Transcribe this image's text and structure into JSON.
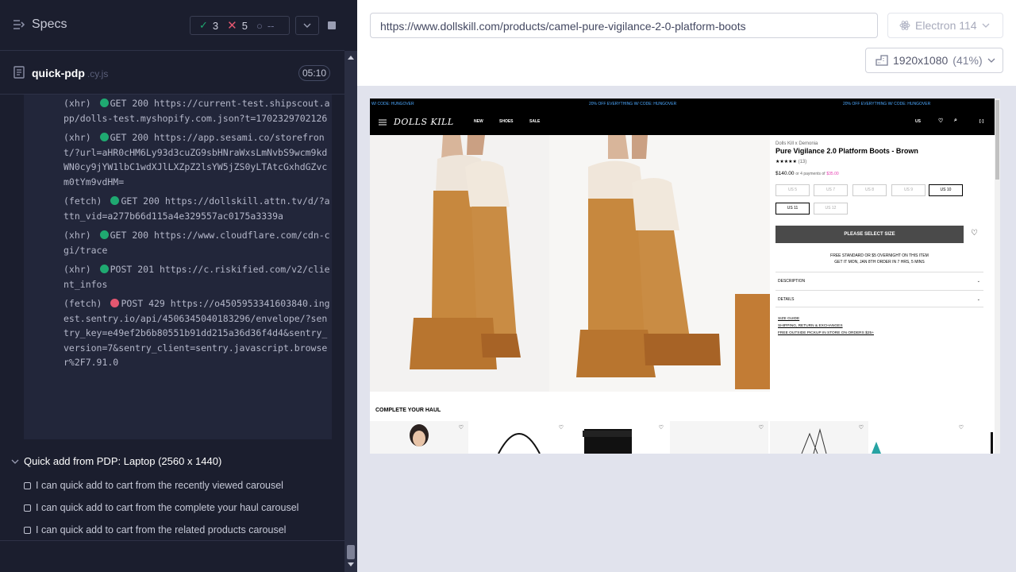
{
  "header": {
    "title": "Specs",
    "passed": "3",
    "failed": "5",
    "pending": "--"
  },
  "spec_file": {
    "name": "quick-pdp",
    "ext": ".cy.js",
    "duration": "05:10"
  },
  "logs": [
    {
      "type": "(xhr)",
      "status": "pass",
      "method": "GET 200",
      "url": "https://current-test.shipscout.app/dolls-test.myshopify.com.json?t=1702329702126"
    },
    {
      "type": "(xhr)",
      "status": "pass",
      "method": "GET 200",
      "url": "https://app.sesami.co/storefront/?url=aHR0cHM6Ly93d3cuZG9sbHNraWxsLmNvbS9wcm9kdWN0cy9jYW1lbC1wdXJlLXZpZ2lsYW5jZS0yLTAtcGxhdGZvcm0tYm9vdHM="
    },
    {
      "type": "(fetch)",
      "status": "pass",
      "method": "GET 200",
      "url": "https://dollskill.attn.tv/d/?attn_vid=a277b66d115a4e329557ac0175a3339a"
    },
    {
      "type": "(xhr)",
      "status": "pass",
      "method": "GET 200",
      "url": "https://www.cloudflare.com/cdn-cgi/trace"
    },
    {
      "type": "(xhr)",
      "status": "pass",
      "method": "POST 201",
      "url": "https://c.riskified.com/v2/client_infos"
    },
    {
      "type": "(fetch)",
      "status": "fail",
      "method": "POST 429",
      "url": "https://o4505953341603840.ingest.sentry.io/api/4506345040183296/envelope/?sentry_key=e49ef2b6b80551b91dd215a36d36f4d4&sentry_version=7&sentry_client=sentry.javascript.browser%2F7.91.0"
    }
  ],
  "suite": {
    "title": "Quick add from PDP: Laptop (2560 x 1440)"
  },
  "tests": [
    "I can quick add to cart from the recently viewed carousel",
    "I can quick add to cart from the complete your haul carousel",
    "I can quick add to cart from the related products carousel"
  ],
  "browser": {
    "url": "https://www.dollskill.com/products/camel-pure-vigilance-2-0-platform-boots",
    "engine": "Electron 114",
    "viewport": "1920x1080",
    "scale": "(41%)"
  },
  "colors": {
    "pass": "#1fa971",
    "fail": "#e45770",
    "accent": "#e63ab1"
  },
  "site": {
    "promo": [
      "W/ CODE: HUNGOVER",
      "20% OFF EVERYTHING W/ CODE: HUNGOVER",
      "20% OFF EVERYTHING W/ CODE: HUNGOVER"
    ],
    "logo": "DOLLS KILL",
    "nav": [
      "NEW",
      "SHOES",
      "SALE"
    ],
    "region": "US",
    "brand": "Dolls Kill x Demonia",
    "title": "Pure Vigilance 2.0 Platform Boots - Brown",
    "stars": "★★★★★",
    "reviews": "(13)",
    "price": "$140.00",
    "installments": "or 4 payments of",
    "installment_amount": "$35.00",
    "sizes": [
      "US 5",
      "US 7",
      "US 8",
      "US 9",
      "US 10",
      "US 11",
      "US 12"
    ],
    "select_btn": "PLEASE SELECT SIZE",
    "ship1": "FREE STANDARD OR $5 OVERNIGHT ON THIS ITEM",
    "ship2": "GET IT MON, JAN 8TH ORDER IN 7 HRS, 5 MINS",
    "acc1": "DESCRIPTION",
    "acc2": "DETAILS",
    "links": [
      "SIZE GUIDE",
      "SHIPPING, RETURN & EXCHANGES",
      "FREE OUTSIDE PICKUP IN STORE ON ORDERS $25+"
    ],
    "haul": "COMPLETE YOUR HAUL"
  }
}
